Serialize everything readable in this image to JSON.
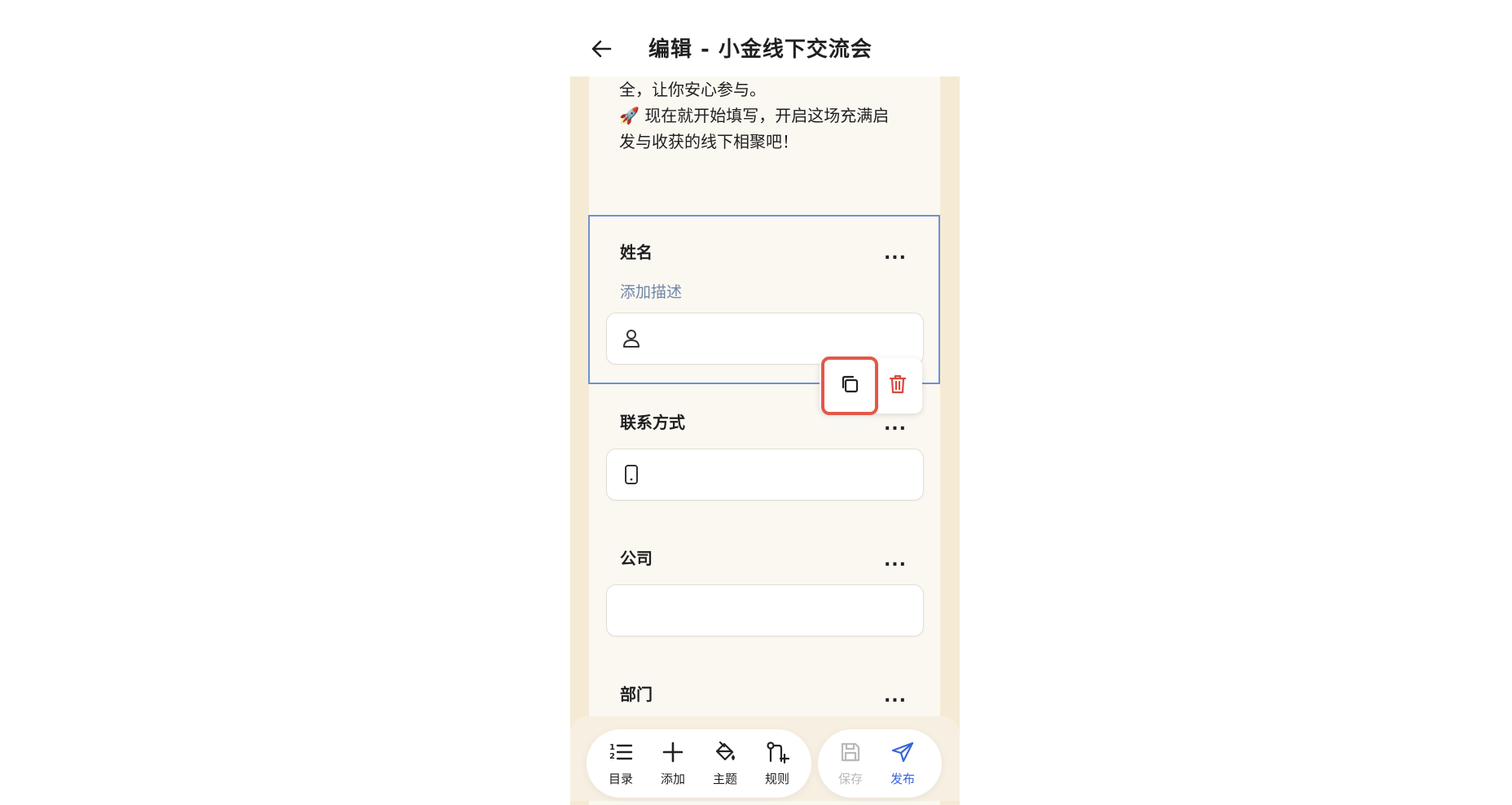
{
  "header": {
    "title": "编辑 - 小金线下交流会"
  },
  "intro": {
    "lines": [
      "全，让你安心参与。",
      "🚀 现在就开始填写，开启这场充满启",
      "发与收获的线下相聚吧！"
    ]
  },
  "fields": [
    {
      "title": "姓名",
      "description_placeholder": "添加描述",
      "icon": "person-icon",
      "more": "..."
    },
    {
      "title": "联系方式",
      "icon": "phone-icon",
      "more": "..."
    },
    {
      "title": "公司",
      "more": "..."
    },
    {
      "title": "部门",
      "more": "..."
    }
  ],
  "float_toolbar": {
    "copy": "copy-icon",
    "delete": "trash-icon"
  },
  "bottom_nav": {
    "items": [
      {
        "label": "目录",
        "icon": "list-ordered-icon"
      },
      {
        "label": "添加",
        "icon": "plus-icon"
      },
      {
        "label": "主题",
        "icon": "paint-bucket-icon"
      },
      {
        "label": "规则",
        "icon": "rule-branch-icon"
      }
    ],
    "save": {
      "label": "保存",
      "icon": "save-icon"
    },
    "publish": {
      "label": "发布",
      "icon": "send-icon"
    }
  },
  "colors": {
    "accent": "#3a64d8",
    "selection": "#6c92d4",
    "highlight": "#e35848",
    "delete": "#d9483b",
    "canvas_bg": "#f5ead4",
    "paper_bg": "#fbf8f2"
  }
}
